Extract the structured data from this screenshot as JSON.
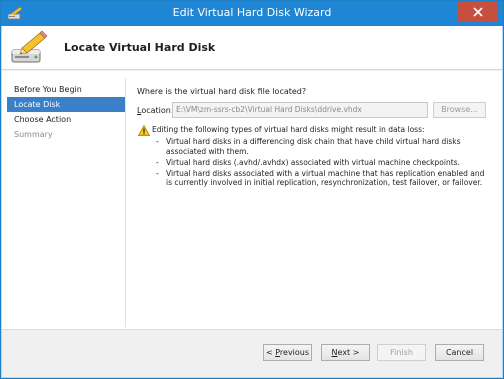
{
  "window": {
    "title": "Edit Virtual Hard Disk Wizard"
  },
  "header": {
    "title": "Locate Virtual Hard Disk"
  },
  "nav": {
    "items": [
      {
        "label": "Before You Begin",
        "state": "normal"
      },
      {
        "label": "Locate Disk",
        "state": "active"
      },
      {
        "label": "Choose Action",
        "state": "normal"
      },
      {
        "label": "Summary",
        "state": "disabled"
      }
    ]
  },
  "main": {
    "question": "Where is the virtual hard disk file located?",
    "location_label_pre": "",
    "location_label_u": "L",
    "location_label_post": "ocation:",
    "location_value": "E:\\VM\\zm-ssrs-cb2\\Virtual Hard Disks\\ddrive.vhdx",
    "browse_label": "Browse...",
    "warning": "Editing the following types of virtual hard disks might result in data loss:",
    "bullets": [
      "Virtual hard disks in a differencing disk chain that have child virtual hard disks associated with them.",
      "Virtual hard disks (.avhd/.avhdx) associated with virtual machine checkpoints.",
      "Virtual hard disks associated with a virtual machine that has replication enabled and is currently involved in initial replication, resynchronization, test failover, or failover."
    ]
  },
  "footer": {
    "previous_pre": "< ",
    "previous_u": "P",
    "previous_post": "revious",
    "next_pre": "",
    "next_u": "N",
    "next_post": "ext >",
    "finish_label": "Finish",
    "cancel_label": "Cancel"
  },
  "icons": {
    "title": "pencil-disk-icon",
    "header": "pencil-disk-icon",
    "warning": "warning-icon",
    "close": "close-icon"
  },
  "colors": {
    "titlebar": "#1e86d4",
    "nav_active": "#3a7fc8",
    "close": "#c74f3f"
  }
}
